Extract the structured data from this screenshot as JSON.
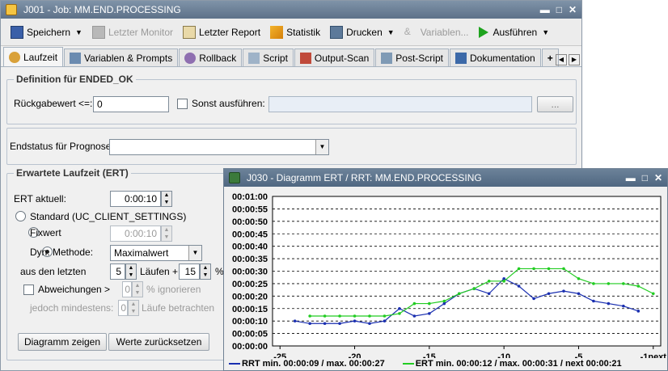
{
  "main_window": {
    "title": "J001 - Job: MM.END.PROCESSING",
    "controls": [
      "▬",
      "□",
      "✕"
    ]
  },
  "toolbar": {
    "save": "Speichern",
    "last_monitor": "Letzter Monitor",
    "last_report": "Letzter Report",
    "statistics": "Statistik",
    "print": "Drucken",
    "variables": "Variablen...",
    "execute": "Ausführen"
  },
  "tabs": [
    {
      "label": "Laufzeit",
      "icon": "runtime-icon"
    },
    {
      "label": "Variablen & Prompts",
      "icon": "variables-icon"
    },
    {
      "label": "Rollback",
      "icon": "rollback-icon"
    },
    {
      "label": "Script",
      "icon": "script-icon"
    },
    {
      "label": "Output-Scan",
      "icon": "output-scan-icon"
    },
    {
      "label": "Post-Script",
      "icon": "post-script-icon"
    },
    {
      "label": "Dokumentation",
      "icon": "documentation-icon"
    }
  ],
  "tab_add": "+",
  "definition": {
    "title": "Definition für ENDED_OK",
    "return_label": "Rückgabewert <=:",
    "return_value": "0",
    "else_label": "Sonst ausführen:",
    "browse": "..."
  },
  "endstatus": {
    "label": "Endstatus für Prognose:",
    "value": ""
  },
  "ert": {
    "title": "Erwartete Laufzeit (ERT)",
    "current_label": "ERT aktuell:",
    "current_value": "0:00:10",
    "standard_label": "Standard (UC_CLIENT_SETTINGS)",
    "fixed_label": "Fixwert",
    "fixed_value": "0:00:10",
    "dyn_label": "Dyn. Methode:",
    "dyn_value": "Maximalwert",
    "last_label": "aus den letzten",
    "last_count": "5",
    "runs_plus": "Läufen +",
    "percent_value": "15",
    "percent_sign": "%",
    "deviation_label": "Abweichungen >",
    "deviation_value": "0",
    "ignore_label": "% ignorieren",
    "min_label": "jedoch mindestens:",
    "min_value": "0",
    "consider_label": "Läufe betrachten",
    "chart_button": "Diagramm zeigen",
    "reset_button": "Werte zurücksetzen"
  },
  "chart_window": {
    "title": "J030 - Diagramm ERT / RRT: MM.END.PROCESSING",
    "controls": [
      "▬",
      "□",
      "✕"
    ]
  },
  "chart_data": {
    "type": "line",
    "colors": {
      "rrt": "#1a2fb0",
      "ert": "#22cc22"
    },
    "grid": true,
    "ylim": [
      0,
      60
    ],
    "y_ticks": [
      "00:00:00",
      "00:00:05",
      "00:00:10",
      "00:00:15",
      "00:00:20",
      "00:00:25",
      "00:00:30",
      "00:00:35",
      "00:00:40",
      "00:00:45",
      "00:00:50",
      "00:00:55",
      "00:01:00"
    ],
    "x_ticks": [
      "-25",
      "-20",
      "-15",
      "-10",
      "-5",
      "-1next"
    ],
    "series": [
      {
        "name": "RRT min. 00:00:09 / max. 00:00:27",
        "x": [
          -24,
          -23,
          -22,
          -21,
          -20,
          -19,
          -18,
          -17,
          -16,
          -15,
          -14,
          -13,
          -12,
          -11,
          -10,
          -9,
          -8,
          -7,
          -6,
          -5,
          -4,
          -3,
          -2,
          -1
        ],
        "values": [
          10,
          9,
          9,
          9,
          10,
          9,
          10,
          15,
          12,
          13,
          17,
          21,
          23,
          21,
          27,
          24,
          19,
          21,
          22,
          21,
          18,
          17,
          16,
          14
        ]
      },
      {
        "name": "ERT min. 00:00:12 / max. 00:00:31 / next 00:00:21",
        "x": [
          -23,
          -22,
          -21,
          -20,
          -19,
          -18,
          -17,
          -16,
          -15,
          -14,
          -13,
          -12,
          -11,
          -10,
          -9,
          -8,
          -7,
          -6,
          -5,
          -4,
          -3,
          -2,
          -1,
          0
        ],
        "values": [
          12,
          12,
          12,
          12,
          12,
          12,
          13,
          17,
          17,
          18,
          21,
          23,
          26,
          26,
          31,
          31,
          31,
          31,
          27,
          25,
          25,
          25,
          24,
          21
        ]
      }
    ]
  }
}
